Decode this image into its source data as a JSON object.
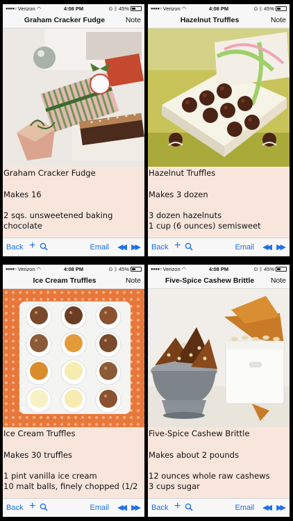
{
  "status_bar": {
    "carrier": "Verizon",
    "time": "4:08 PM",
    "battery": "45%",
    "battery_level": 0.45
  },
  "toolbar": {
    "back_label": "Back",
    "email_label": "Email"
  },
  "screens": [
    {
      "title": "Graham Cracker Fudge",
      "note_label": "Note",
      "recipe_lines": [
        "Graham Cracker Fudge",
        "",
        "Makes 16",
        "",
        "2 sqs. unsweetened baking",
        "chocolate"
      ]
    },
    {
      "title": "Hazelnut Truffles",
      "note_label": "Note",
      "recipe_lines": [
        "Hazelnut Truffles",
        "",
        "Makes 3 dozen",
        "",
        "3 dozen hazelnuts",
        "1 cup (6 ounces) semisweet"
      ]
    },
    {
      "title": "Ice Cream Truffles",
      "note_label": "Note",
      "recipe_lines": [
        "Ice Cream Truffles",
        "",
        "Makes 30 truffles",
        "",
        "1 pint vanilla ice cream",
        "10 malt balls, finely chopped (1/2"
      ]
    },
    {
      "title": "Five-Spice Cashew Brittle",
      "note_label": "Note",
      "recipe_lines": [
        "Five-Spice Cashew Brittle",
        "",
        "Makes about 2 pounds",
        "",
        "12 ounces whole raw cashews",
        "3 cups sugar"
      ]
    }
  ]
}
